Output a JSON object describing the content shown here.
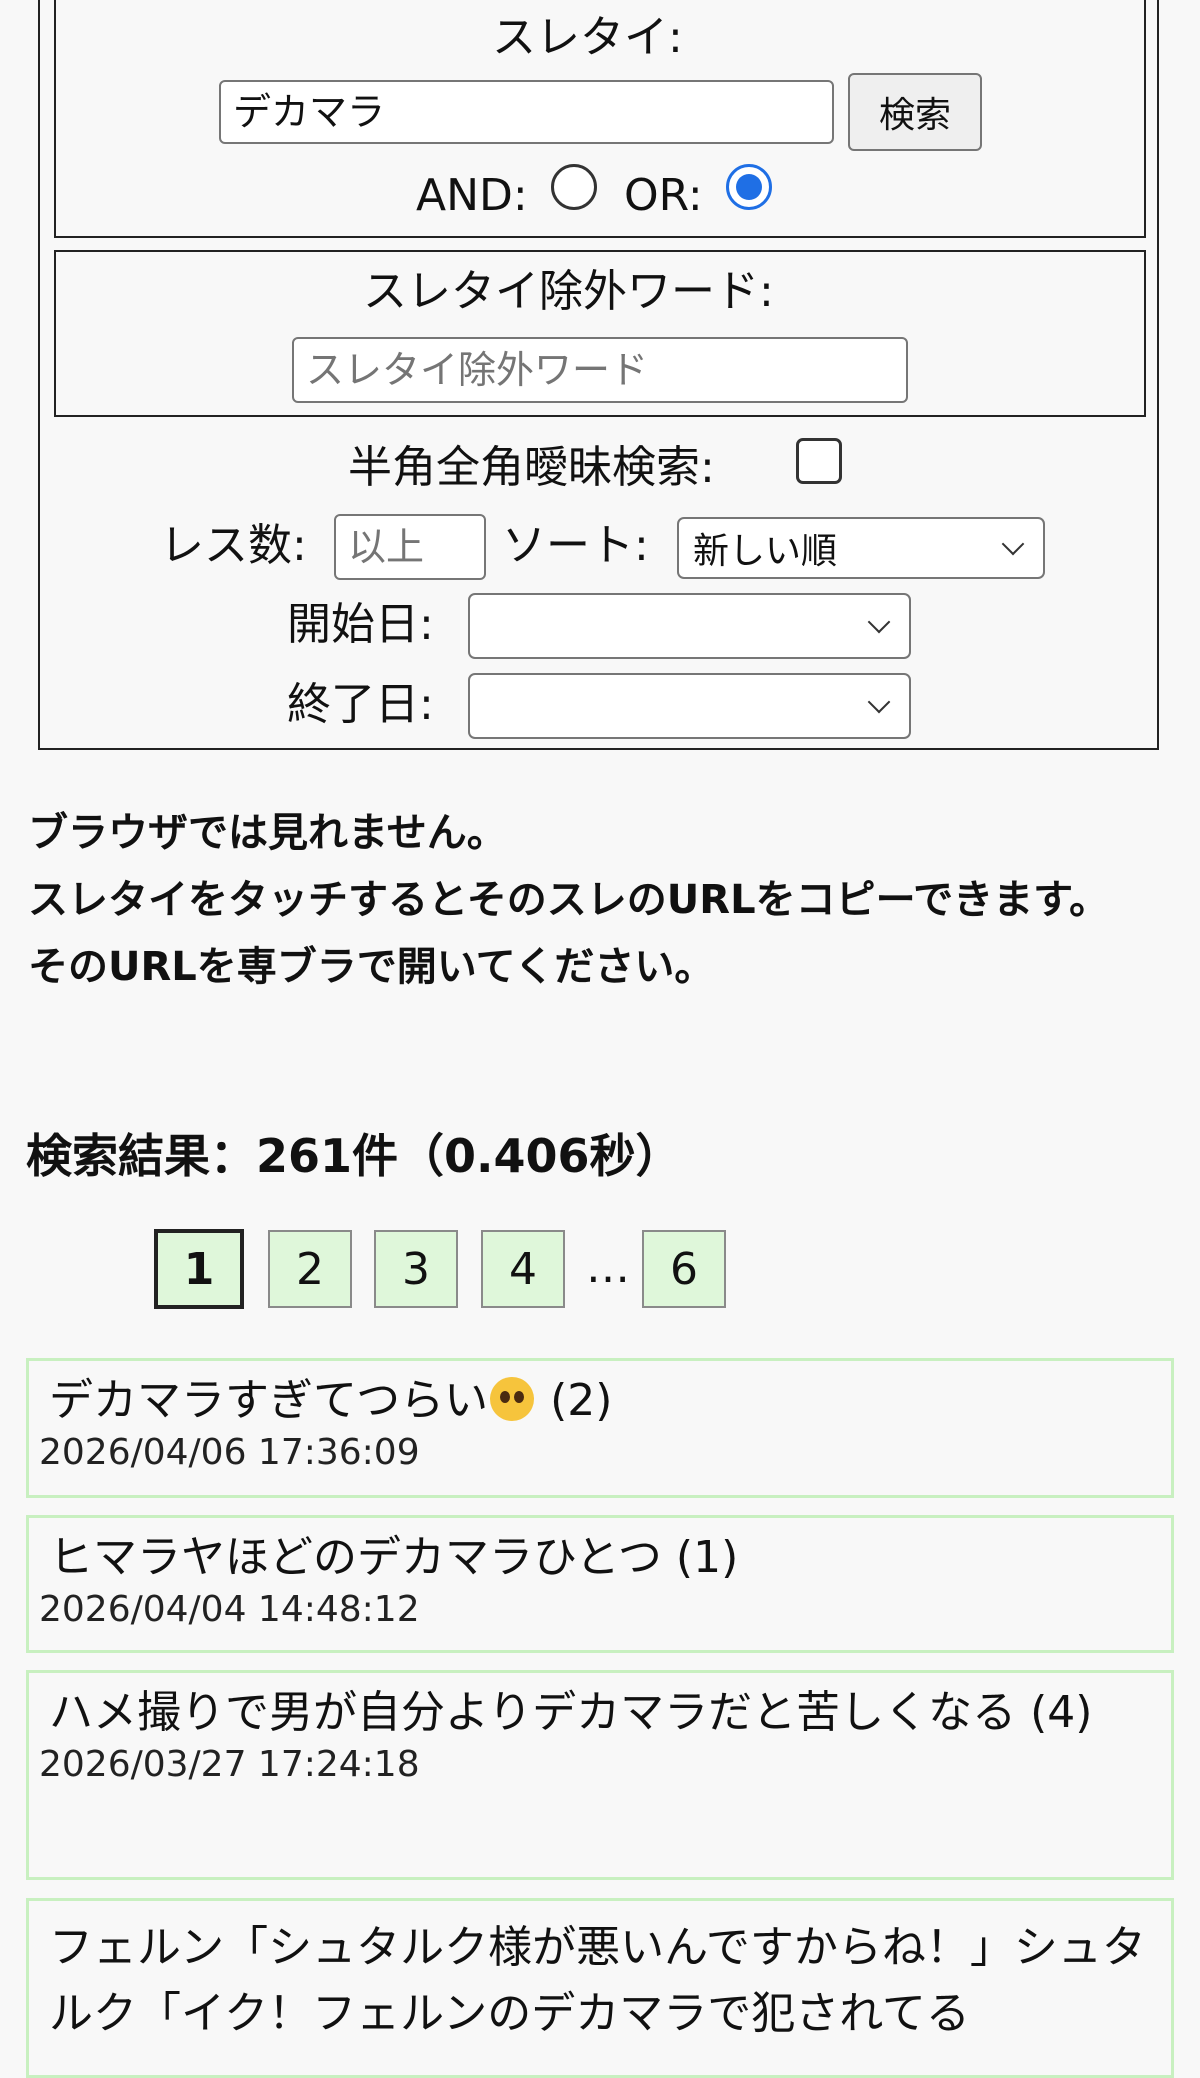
{
  "search_form": {
    "title_label": "スレタイ:",
    "title_value": "デカマラ",
    "search_button": "検索",
    "and_label": "AND:",
    "or_label": "OR:",
    "mode_selected": "OR",
    "exclude_label": "スレタイ除外ワード:",
    "exclude_placeholder": "スレタイ除外ワード",
    "fuzzy_label": "半角全角曖昧検索:",
    "fuzzy_checked": false,
    "res_label": "レス数:",
    "res_placeholder": "以上",
    "sort_label": "ソート:",
    "sort_value": "新しい順",
    "start_label": "開始日:",
    "start_value": "",
    "end_label": "終了日:",
    "end_value": ""
  },
  "notice": {
    "line1": "ブラウザでは見れません。",
    "line2": "スレタイをタッチするとそのスレのURLをコピーできます。",
    "line3": "そのURLを専ブラで開いてください。"
  },
  "results": {
    "summary": "検索結果：261件（0.406秒）"
  },
  "pagination": {
    "current": "1",
    "pages": [
      "2",
      "3",
      "4"
    ],
    "ellipsis": "…",
    "last": "6"
  },
  "threads": [
    {
      "title": "デカマラすぎてつらい",
      "emoji": "pleading-face",
      "count": "(2)",
      "date": "2026/04/06 17:36:09"
    },
    {
      "title": "ヒマラヤほどのデカマラひとつ (1)",
      "date": "2026/04/04 14:48:12"
    },
    {
      "title": "ハメ撮りで男が自分よりデカマラだと苦しくなる (4)",
      "date": "2026/03/27 17:24:18"
    },
    {
      "title": "フェルン「シュタルク様が悪いんですからね！」シュタルク「イク！フェルンのデカマラで犯されてる",
      "date": ""
    }
  ]
}
